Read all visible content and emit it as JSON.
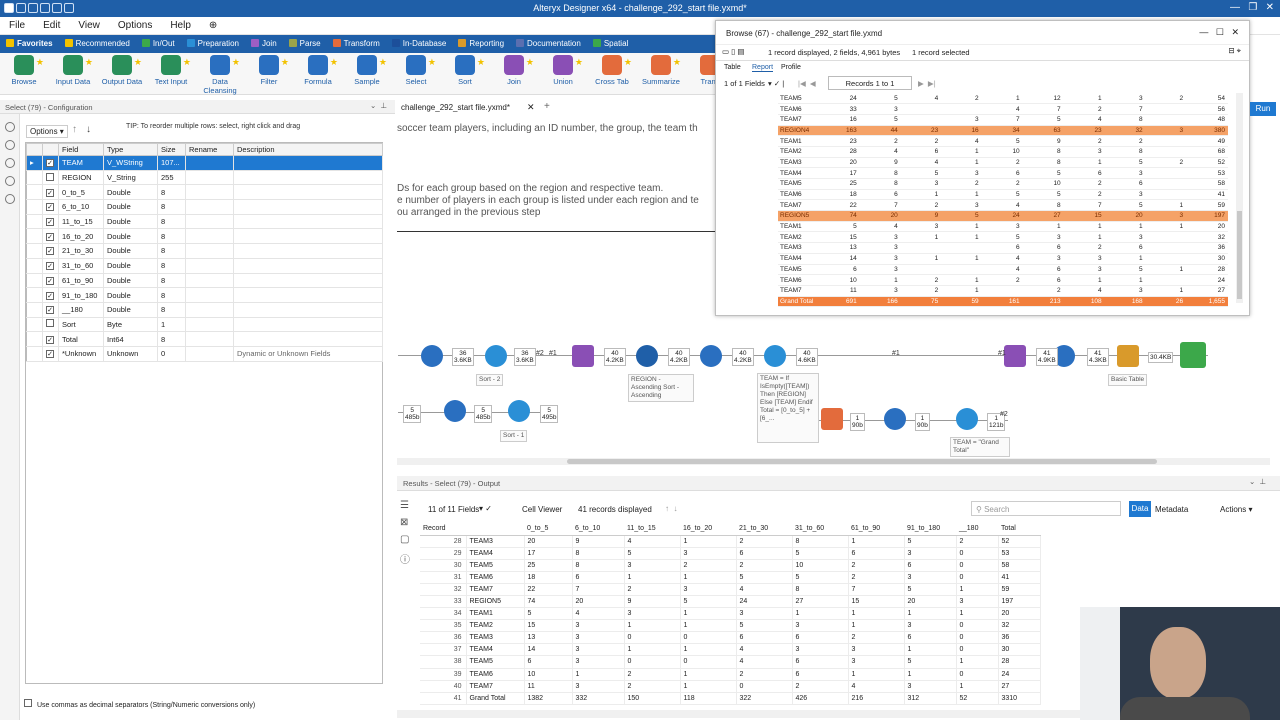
{
  "app": {
    "title": "Alteryx Designer x64 - challenge_292_start file.yxmd*"
  },
  "menu": [
    "File",
    "Edit",
    "View",
    "Options",
    "Help"
  ],
  "ribbon_tabs": [
    {
      "label": "Favorites",
      "color": "#f2c200"
    },
    {
      "label": "Recommended",
      "color": "#f2c200"
    },
    {
      "label": "In/Out",
      "color": "#3ca84a"
    },
    {
      "label": "Preparation",
      "color": "#2a8fd6"
    },
    {
      "label": "Join",
      "color": "#9c5ec4"
    },
    {
      "label": "Parse",
      "color": "#9aa44a"
    },
    {
      "label": "Transform",
      "color": "#e36b3c"
    },
    {
      "label": "In-Database",
      "color": "#1c4f9a"
    },
    {
      "label": "Reporting",
      "color": "#d99a2b"
    },
    {
      "label": "Documentation",
      "color": "#5a6fb0"
    },
    {
      "label": "Spatial",
      "color": "#3ca84a"
    }
  ],
  "tools": [
    "Browse",
    "Input Data",
    "Output Data",
    "Text Input",
    "Data Cleansing",
    "Filter",
    "Formula",
    "Sample",
    "Select",
    "Sort",
    "Join",
    "Union",
    "Cross Tab",
    "Summarize",
    "Trans"
  ],
  "config": {
    "header": "Select (79) - Configuration",
    "options_label": "Options",
    "tip": "TIP: To reorder multiple rows: select, right click and drag",
    "columns": [
      "Field",
      "Type",
      "Size",
      "Rename",
      "Description"
    ],
    "rows": [
      {
        "checked": "✓",
        "field": "TEAM",
        "type": "V_WString",
        "size": "107...",
        "desc": ""
      },
      {
        "checked": "",
        "field": "REGION",
        "type": "V_String",
        "size": "255",
        "desc": ""
      },
      {
        "checked": "✓",
        "field": "0_to_5",
        "type": "Double",
        "size": "8",
        "desc": ""
      },
      {
        "checked": "✓",
        "field": "6_to_10",
        "type": "Double",
        "size": "8",
        "desc": ""
      },
      {
        "checked": "✓",
        "field": "11_to_15",
        "type": "Double",
        "size": "8",
        "desc": ""
      },
      {
        "checked": "✓",
        "field": "16_to_20",
        "type": "Double",
        "size": "8",
        "desc": ""
      },
      {
        "checked": "✓",
        "field": "21_to_30",
        "type": "Double",
        "size": "8",
        "desc": ""
      },
      {
        "checked": "✓",
        "field": "31_to_60",
        "type": "Double",
        "size": "8",
        "desc": ""
      },
      {
        "checked": "✓",
        "field": "61_to_90",
        "type": "Double",
        "size": "8",
        "desc": ""
      },
      {
        "checked": "✓",
        "field": "91_to_180",
        "type": "Double",
        "size": "8",
        "desc": ""
      },
      {
        "checked": "✓",
        "field": "__180",
        "type": "Double",
        "size": "8",
        "desc": ""
      },
      {
        "checked": "",
        "field": "Sort",
        "type": "Byte",
        "size": "1",
        "desc": ""
      },
      {
        "checked": "✓",
        "field": "Total",
        "type": "Int64",
        "size": "8",
        "desc": ""
      },
      {
        "checked": "✓",
        "field": "*Unknown",
        "type": "Unknown",
        "size": "0",
        "desc": "Dynamic or Unknown Fields"
      }
    ],
    "comma_option": "Use commas as decimal separators (String/Numeric conversions only)"
  },
  "canvas": {
    "tab": "challenge_292_start file.yxmd*",
    "text_lines": [
      "soccer team players, including an ID number, the group, the team th",
      "Ds for each group based on the region and respective team.",
      "e number of players in each group is listed under each region and te",
      "ou arranged in the previous step"
    ],
    "sizes": [
      "36\n3.6KB",
      "36\n3.6KB",
      "40\n4.2KB",
      "40\n4.2KB",
      "40\n4.2KB",
      "40\n4.6KB",
      "5\n485b",
      "5\n485b",
      "5\n495b",
      "1\n90b",
      "1\n90b",
      "1\n121b",
      "41\n4.9KB",
      "41\n4.3KB",
      "30.4KB"
    ],
    "annotations": [
      "Sort - 2",
      "Sort - 1",
      "REGION - Ascending Sort - Ascending",
      "TEAM = If IsEmpty([TEAM]) Then [REGION] Else [TEAM] Endif Total = [0_to_5] + [6_...",
      "TEAM = \"Grand Total\"",
      "Basic Table"
    ],
    "connection_labels": [
      "#1",
      "#2",
      "#1",
      "#1",
      "#2"
    ]
  },
  "browse": {
    "title": "Browse (67) - challenge_292_start file.yxmd",
    "info": "1 record displayed, 2 fields, 4,961 bytes",
    "selected": "1 record selected",
    "tabs": [
      "Table",
      "Report",
      "Profile"
    ],
    "fields_label": "1 of 1 Fields",
    "records_label": "Records 1 to 1",
    "rows": [
      {
        "kind": "",
        "cells": [
          "TEAM5",
          "24",
          "5",
          "4",
          "2",
          "1",
          "12",
          "1",
          "3",
          "2",
          "54"
        ]
      },
      {
        "kind": "",
        "cells": [
          "TEAM6",
          "33",
          "3",
          "",
          "",
          "4",
          "7",
          "2",
          "7",
          "",
          "56"
        ]
      },
      {
        "kind": "",
        "cells": [
          "TEAM7",
          "16",
          "5",
          "",
          "3",
          "7",
          "5",
          "4",
          "8",
          "",
          "48"
        ]
      },
      {
        "kind": "rg",
        "cells": [
          "REGION4",
          "163",
          "44",
          "23",
          "16",
          "34",
          "63",
          "23",
          "32",
          "3",
          "380"
        ]
      },
      {
        "kind": "",
        "cells": [
          "TEAM1",
          "23",
          "2",
          "2",
          "4",
          "5",
          "9",
          "2",
          "2",
          "",
          "49"
        ]
      },
      {
        "kind": "",
        "cells": [
          "TEAM2",
          "28",
          "4",
          "6",
          "1",
          "10",
          "8",
          "3",
          "8",
          "",
          "68"
        ]
      },
      {
        "kind": "",
        "cells": [
          "TEAM3",
          "20",
          "9",
          "4",
          "1",
          "2",
          "8",
          "1",
          "5",
          "2",
          "52"
        ]
      },
      {
        "kind": "",
        "cells": [
          "TEAM4",
          "17",
          "8",
          "5",
          "3",
          "6",
          "5",
          "6",
          "3",
          "",
          "53"
        ]
      },
      {
        "kind": "",
        "cells": [
          "TEAM5",
          "25",
          "8",
          "3",
          "2",
          "2",
          "10",
          "2",
          "6",
          "",
          "58"
        ]
      },
      {
        "kind": "",
        "cells": [
          "TEAM6",
          "18",
          "6",
          "1",
          "1",
          "5",
          "5",
          "2",
          "3",
          "",
          "41"
        ]
      },
      {
        "kind": "",
        "cells": [
          "TEAM7",
          "22",
          "7",
          "2",
          "3",
          "4",
          "8",
          "7",
          "5",
          "1",
          "59"
        ]
      },
      {
        "kind": "rg",
        "cells": [
          "REGION5",
          "74",
          "20",
          "9",
          "5",
          "24",
          "27",
          "15",
          "20",
          "3",
          "197"
        ]
      },
      {
        "kind": "",
        "cells": [
          "TEAM1",
          "5",
          "4",
          "3",
          "1",
          "3",
          "1",
          "1",
          "1",
          "1",
          "20"
        ]
      },
      {
        "kind": "",
        "cells": [
          "TEAM2",
          "15",
          "3",
          "1",
          "1",
          "5",
          "3",
          "1",
          "3",
          "",
          "32"
        ]
      },
      {
        "kind": "",
        "cells": [
          "TEAM3",
          "13",
          "3",
          "",
          "",
          "6",
          "6",
          "2",
          "6",
          "",
          "36"
        ]
      },
      {
        "kind": "",
        "cells": [
          "TEAM4",
          "14",
          "3",
          "1",
          "1",
          "4",
          "3",
          "3",
          "1",
          "",
          "30"
        ]
      },
      {
        "kind": "",
        "cells": [
          "TEAM5",
          "6",
          "3",
          "",
          "",
          "4",
          "6",
          "3",
          "5",
          "1",
          "28"
        ]
      },
      {
        "kind": "",
        "cells": [
          "TEAM6",
          "10",
          "1",
          "2",
          "1",
          "2",
          "6",
          "1",
          "1",
          "",
          "24"
        ]
      },
      {
        "kind": "",
        "cells": [
          "TEAM7",
          "11",
          "3",
          "2",
          "1",
          "",
          "2",
          "4",
          "3",
          "1",
          "27"
        ]
      },
      {
        "kind": "gt",
        "cells": [
          "Grand Total",
          "691",
          "166",
          "75",
          "59",
          "161",
          "213",
          "108",
          "168",
          "26",
          "1,655"
        ]
      }
    ]
  },
  "results": {
    "header": "Results - Select (79) - Output",
    "fields_label": "11 of 11 Fields",
    "viewer_label": "Cell Viewer",
    "records_label": "41 records displayed",
    "search_placeholder": "Search",
    "data_tab": "Data",
    "metadata_tab": "Metadata",
    "actions_label": "Actions",
    "columns": [
      "Record",
      "",
      "0_to_5",
      "6_to_10",
      "11_to_15",
      "16_to_20",
      "21_to_30",
      "31_to_60",
      "61_to_90",
      "91_to_180",
      "__180",
      "Total"
    ],
    "rows": [
      [
        "28",
        "TEAM3",
        "20",
        "9",
        "4",
        "1",
        "2",
        "8",
        "1",
        "5",
        "2",
        "52"
      ],
      [
        "29",
        "TEAM4",
        "17",
        "8",
        "5",
        "3",
        "6",
        "5",
        "6",
        "3",
        "0",
        "53"
      ],
      [
        "30",
        "TEAM5",
        "25",
        "8",
        "3",
        "2",
        "2",
        "10",
        "2",
        "6",
        "0",
        "58"
      ],
      [
        "31",
        "TEAM6",
        "18",
        "6",
        "1",
        "1",
        "5",
        "5",
        "2",
        "3",
        "0",
        "41"
      ],
      [
        "32",
        "TEAM7",
        "22",
        "7",
        "2",
        "3",
        "4",
        "8",
        "7",
        "5",
        "1",
        "59"
      ],
      [
        "33",
        "REGION5",
        "74",
        "20",
        "9",
        "5",
        "24",
        "27",
        "15",
        "20",
        "3",
        "197"
      ],
      [
        "34",
        "TEAM1",
        "5",
        "4",
        "3",
        "1",
        "3",
        "1",
        "1",
        "1",
        "1",
        "20"
      ],
      [
        "35",
        "TEAM2",
        "15",
        "3",
        "1",
        "1",
        "5",
        "3",
        "1",
        "3",
        "0",
        "32"
      ],
      [
        "36",
        "TEAM3",
        "13",
        "3",
        "0",
        "0",
        "6",
        "6",
        "2",
        "6",
        "0",
        "36"
      ],
      [
        "37",
        "TEAM4",
        "14",
        "3",
        "1",
        "1",
        "4",
        "3",
        "3",
        "1",
        "0",
        "30"
      ],
      [
        "38",
        "TEAM5",
        "6",
        "3",
        "0",
        "0",
        "4",
        "6",
        "3",
        "5",
        "1",
        "28"
      ],
      [
        "39",
        "TEAM6",
        "10",
        "1",
        "2",
        "1",
        "2",
        "6",
        "1",
        "1",
        "0",
        "24"
      ],
      [
        "40",
        "TEAM7",
        "11",
        "3",
        "2",
        "1",
        "0",
        "2",
        "4",
        "3",
        "1",
        "27"
      ],
      [
        "41",
        "Grand Total",
        "1382",
        "332",
        "150",
        "118",
        "322",
        "426",
        "216",
        "312",
        "52",
        "3310"
      ]
    ]
  },
  "run_label": "Run"
}
